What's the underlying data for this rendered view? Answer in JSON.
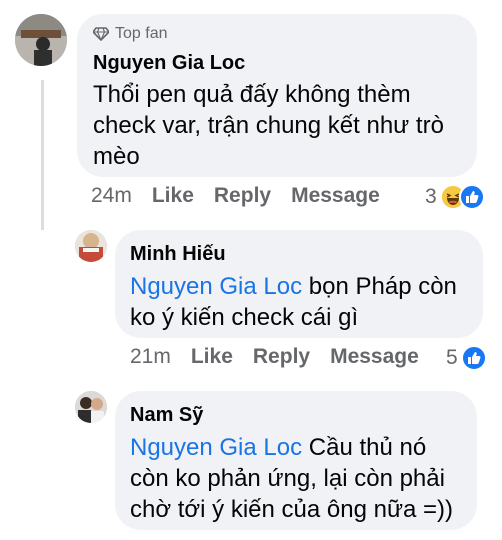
{
  "comments": [
    {
      "badge": "Top fan",
      "author": "Nguyen Gia Loc",
      "text": "Thổi pen quả đấy không thèm check var, trận chung kết như trò mèo",
      "time": "24m",
      "actions": [
        "Like",
        "Reply",
        "Message"
      ],
      "reaction_count": "3",
      "reactions": [
        "haha",
        "like"
      ]
    },
    {
      "author": "Minh Hiếu",
      "mention": "Nguyen Gia Loc",
      "text": " bọn Pháp còn ko ý kiến check cái gì",
      "time": "21m",
      "actions": [
        "Like",
        "Reply",
        "Message"
      ],
      "reaction_count": "5",
      "reactions": [
        "like"
      ]
    },
    {
      "author": "Nam Sỹ",
      "mention": "Nguyen Gia Loc",
      "text": " Cầu thủ nó còn ko phản ứng, lại còn phải chờ tới ý kiến của ông nữa =))"
    }
  ],
  "colors": {
    "mention": "#1b74e4",
    "bubble": "#f0f2f5",
    "secondary_text": "#65676b",
    "like_blue": "#1877f2",
    "haha_yellow": "#f7c844"
  }
}
